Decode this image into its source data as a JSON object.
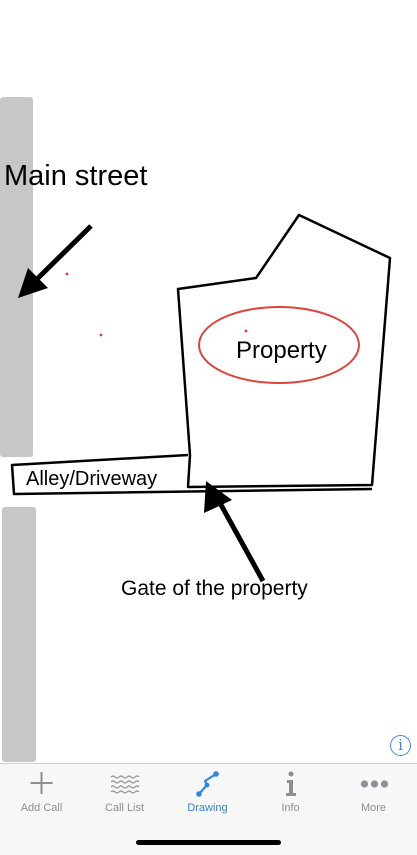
{
  "canvas": {
    "labels": {
      "main_street": "Main street",
      "property": "Property",
      "alley": "Alley/Driveway",
      "gate": "Gate of the property"
    }
  },
  "info_button": {
    "glyph": "i",
    "icon": "info-circle-icon"
  },
  "tab_bar": {
    "items": [
      {
        "label": "Add Call",
        "icon": "plus-icon",
        "active": false
      },
      {
        "label": "Call List",
        "icon": "list-icon",
        "active": false
      },
      {
        "label": "Drawing",
        "icon": "drawing-icon",
        "active": true
      },
      {
        "label": "Info",
        "icon": "info-icon",
        "active": false
      },
      {
        "label": "More",
        "icon": "more-dots-icon",
        "active": false
      }
    ]
  },
  "colors": {
    "accent": "#2e86de",
    "inactive": "#8e8e93",
    "street": "#c7c7c7",
    "property_oval": "#d9463c",
    "marker_dot": "#e53935"
  }
}
